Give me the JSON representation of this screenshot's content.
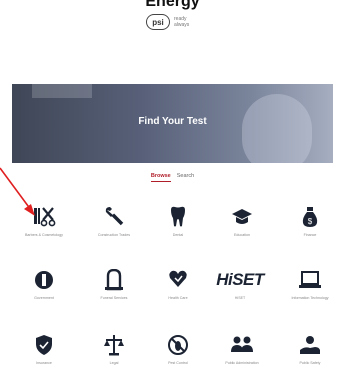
{
  "page": {
    "heading": "Energy",
    "title": "Find Your Test"
  },
  "brand": {
    "badge": "psi",
    "text": "ready",
    "subtext": "always"
  },
  "tabs": [
    {
      "label": "Browse",
      "active": true
    },
    {
      "label": "Search",
      "active": false
    }
  ],
  "categories": [
    {
      "name": "Barbers & Cosmetology",
      "icon": "scissors-comb-icon"
    },
    {
      "name": "Construction Trades",
      "icon": "wrench-icon"
    },
    {
      "name": "Dental",
      "icon": "tooth-icon"
    },
    {
      "name": "Education",
      "icon": "graduation-cap-icon"
    },
    {
      "name": "Finance",
      "icon": "money-bag-icon"
    },
    {
      "name": "Government",
      "icon": "seal-icon"
    },
    {
      "name": "Funeral Services",
      "icon": "memorial-icon"
    },
    {
      "name": "Health Care",
      "icon": "heart-hand-icon"
    },
    {
      "name": "HiSET",
      "icon": "hiset-logo"
    },
    {
      "name": "Information Technology",
      "icon": "laptop-icon"
    },
    {
      "name": "Insurance",
      "icon": "shield-icon"
    },
    {
      "name": "Legal",
      "icon": "scales-icon"
    },
    {
      "name": "Pest Control",
      "icon": "pest-icon"
    },
    {
      "name": "Public Administration",
      "icon": "people-icon"
    },
    {
      "name": "Public Safety",
      "icon": "hand-safety-icon"
    }
  ],
  "colors": {
    "accent": "#b01e2a",
    "icon": "#1c2433",
    "arrow": "#e02020"
  }
}
